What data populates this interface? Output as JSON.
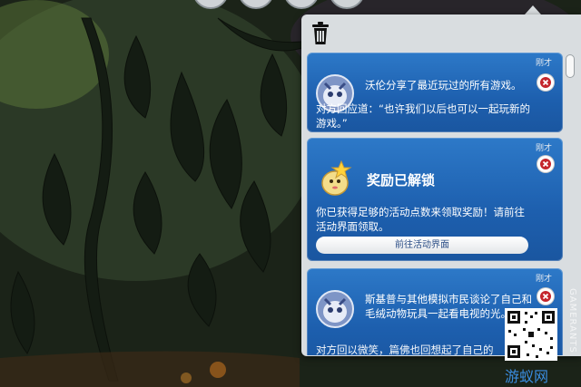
{
  "panel": {
    "trash_icon": "trash-icon",
    "notifications": [
      {
        "time": "刚才",
        "icon": "creature-avatar-icon",
        "text_1": "沃伦分享了最近玩过的所有游戏。",
        "text_2": "对方回应道：“也许我们以后也可以一起玩新的游戏。”"
      },
      {
        "time": "刚才",
        "icon": "reward-mascot-icon",
        "title": "奖励已解锁",
        "text": "你已获得足够的活动点数来领取奖励！请前往活动界面领取。",
        "button_label": "前往活动界面"
      },
      {
        "time": "刚才",
        "icon": "creature-avatar-icon",
        "text_1": "斯基普与其他模拟市民谈论了自己和毛绒动物玩具一起看电视的光。",
        "text_2": "对方回以微笑，篇佛也回想起了自己的"
      }
    ]
  },
  "watermark": {
    "site": "游蚁网",
    "brand": "GAMERANTS"
  }
}
